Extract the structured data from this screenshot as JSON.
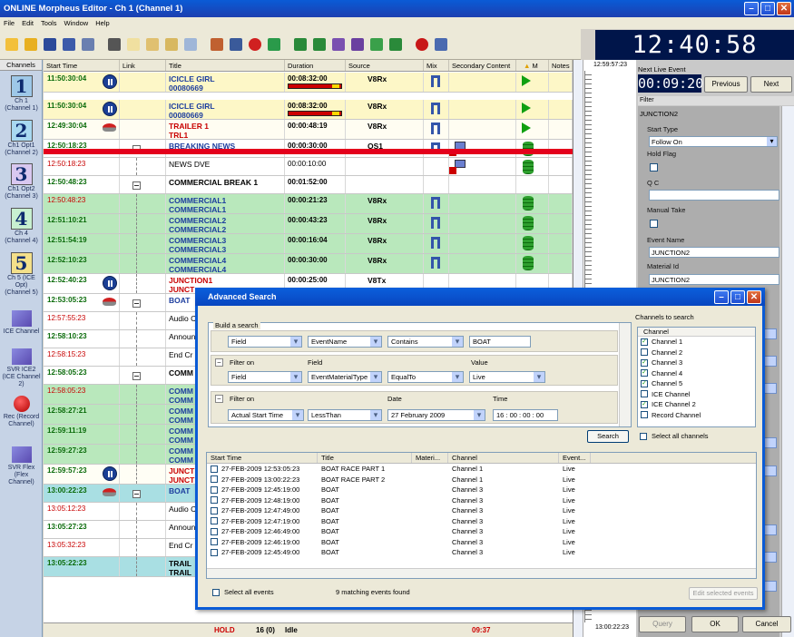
{
  "window": {
    "title": "ONLINE Morpheus Editor - Ch 1 (Channel 1)",
    "menu": [
      "File",
      "Edit",
      "Tools",
      "Window",
      "Help"
    ]
  },
  "clock": "12:40:58",
  "sidebar": {
    "header": "Channels",
    "items": [
      {
        "num": "1",
        "label": "Ch 1 (Channel 1)",
        "color": "#9ec8e8"
      },
      {
        "num": "2",
        "label": "Ch1 Opt1 (Channel 2)",
        "color": "#a8d8f0"
      },
      {
        "num": "3",
        "label": "Ch1 Opt2 (Channel 3)",
        "color": "#d9c8f0"
      },
      {
        "num": "4",
        "label": "Ch 4 (Channel 4)",
        "color": "#c8f0d0"
      },
      {
        "num": "5",
        "label": "Ch 5 (ICE Opt) (Channel 5)",
        "color": "#f4e08a"
      },
      {
        "label": "ICE Channel",
        "icon": "ice-channel-icon"
      },
      {
        "label": "SVR ICE2 (ICE Channel 2)",
        "icon": "server-icon"
      },
      {
        "label": "Rec (Record Channel)",
        "icon": "record-icon"
      },
      {
        "label": "SVR Flex (Flex Channel)",
        "icon": "server-icon"
      }
    ]
  },
  "grid": {
    "columns": [
      "Start Time",
      "Link",
      "Title",
      "Duration",
      "Source",
      "Mix",
      "Secondary Content",
      "M",
      "Notes"
    ],
    "rows": [
      {
        "time": "11:50:30:04",
        "tc": "green",
        "title": "ICICLE GIRL",
        "title2": "00080669",
        "ttc": "blue",
        "dur": "00:08:32:00",
        "bar": true,
        "src": "V8Rx",
        "bg": "#fdf7c7",
        "icon": "pause",
        "mix": true,
        "status": "play"
      },
      {
        "time": "11:50:30:04",
        "tc": "green",
        "title": "ICICLE GIRL",
        "title2": "00080669",
        "ttc": "blue",
        "dur": "00:08:32:00",
        "bar": true,
        "src": "V8Rx",
        "bg": "#fdf7c7",
        "icon": "pause",
        "mix": true,
        "status": "play"
      },
      {
        "time": "12:49:30:04",
        "tc": "green",
        "title": "TRAILER 1",
        "title2": "TRL1",
        "ttc": "red",
        "dur": "00:00:48:19",
        "src": "V8Rx",
        "bg": "#fffdf2",
        "icon": "disc",
        "mix": true,
        "status": "play-end"
      },
      {
        "time": "12:50:18:23",
        "tc": "green",
        "title": "BREAKING NEWS",
        "ttc": "blue",
        "dur": "00:00:30:00",
        "src": "OS1",
        "bg": "#fff",
        "link": true,
        "mix": true,
        "sec": true,
        "status": "db"
      },
      {
        "time": "12:50:18:23",
        "tc": "red",
        "title": "NEWS DVE",
        "ttc": "black",
        "normal": true,
        "dur": "00:00:10:00",
        "bg": "#fff",
        "sec": true,
        "status": "db"
      },
      {
        "time": "12:50:48:23",
        "tc": "green",
        "title": "COMMERCIAL BREAK 1",
        "ttc": "black",
        "dur": "00:01:52:00",
        "bg": "#fff",
        "link": true
      },
      {
        "time": "12:50:48:23",
        "tc": "red",
        "title": "COMMERCIAL1",
        "title2": "COMMERCIAL1",
        "ttc": "blue",
        "dur": "00:00:21:23",
        "src": "V8Rx",
        "bg": "#b9e8bc",
        "mix": true,
        "status": "db"
      },
      {
        "time": "12:51:10:21",
        "tc": "green",
        "title": "COMMERCIAL2",
        "title2": "COMMERCIAL2",
        "ttc": "blue",
        "dur": "00:00:43:23",
        "src": "V8Rx",
        "bg": "#b9e8bc",
        "mix": true,
        "status": "db"
      },
      {
        "time": "12:51:54:19",
        "tc": "green",
        "title": "COMMERCIAL3",
        "title2": "COMMERCIAL3",
        "ttc": "blue",
        "dur": "00:00:16:04",
        "src": "V8Rx",
        "bg": "#b9e8bc",
        "mix": true,
        "status": "db"
      },
      {
        "time": "12:52:10:23",
        "tc": "green",
        "title": "COMMERCIAL4",
        "title2": "COMMERCIAL4",
        "ttc": "blue",
        "dur": "00:00:30:00",
        "src": "V8Rx",
        "bg": "#b9e8bc",
        "mix": true,
        "status": "db"
      },
      {
        "time": "12:52:40:23",
        "tc": "green",
        "title": "JUNCTION1",
        "title2": "JUNCT",
        "ttc": "red",
        "dur": "00:00:25:00",
        "src": "V8Tx",
        "bg": "#fff",
        "icon": "pause"
      },
      {
        "time": "12:53:05:23",
        "tc": "green",
        "title": "BOAT",
        "ttc": "blue",
        "bg": "#fff",
        "icon": "disc",
        "link": true
      },
      {
        "time": "12:57:55:23",
        "tc": "red",
        "title": "Audio C",
        "ttc": "black",
        "normal": true,
        "bg": "#fff"
      },
      {
        "time": "12:58:10:23",
        "tc": "green",
        "title": "Announ",
        "ttc": "black",
        "normal": true,
        "bg": "#fff"
      },
      {
        "time": "12:58:15:23",
        "tc": "red",
        "title": "End Cr",
        "ttc": "black",
        "normal": true,
        "bg": "#fff"
      },
      {
        "time": "12:58:05:23",
        "tc": "green",
        "title": "COMM",
        "ttc": "black",
        "bg": "#fff",
        "link": true
      },
      {
        "time": "12:58:05:23",
        "tc": "red",
        "title": "COMM",
        "title2": "COMM",
        "ttc": "blue",
        "bg": "#b9e8bc"
      },
      {
        "time": "12:58:27:21",
        "tc": "green",
        "title": "COMM",
        "title2": "COMM",
        "ttc": "blue",
        "bg": "#b9e8bc"
      },
      {
        "time": "12:59:11:19",
        "tc": "green",
        "title": "COMM",
        "title2": "COMM",
        "ttc": "blue",
        "bg": "#b9e8bc"
      },
      {
        "time": "12:59:27:23",
        "tc": "green",
        "title": "COMM",
        "title2": "COMM",
        "ttc": "blue",
        "bg": "#b9e8bc"
      },
      {
        "time": "12:59:57:23",
        "tc": "green",
        "title": "JUNCT",
        "title2": "JUNCT",
        "ttc": "red",
        "bg": "#fffef5",
        "icon": "pause"
      },
      {
        "time": "13:00:22:23",
        "tc": "green",
        "title": "BOAT",
        "ttc": "blue",
        "bg": "#a9dfe3",
        "icon": "disc",
        "link": true
      },
      {
        "time": "13:05:12:23",
        "tc": "red",
        "title": "Audio C",
        "ttc": "black",
        "normal": true,
        "bg": "#fff"
      },
      {
        "time": "13:05:27:23",
        "tc": "green",
        "title": "Announ",
        "ttc": "black",
        "normal": true,
        "bg": "#fff"
      },
      {
        "time": "13:05:32:23",
        "tc": "red",
        "title": "End Cr",
        "ttc": "black",
        "normal": true,
        "bg": "#fff"
      },
      {
        "time": "13:05:22:23",
        "tc": "green",
        "title": "TRAIL",
        "title2": "TRAIL",
        "ttc": "black",
        "bg": "#a9dfe3"
      }
    ]
  },
  "status": {
    "state": "HOLD",
    "count": "16 (0)",
    "mode": "Idle",
    "time": "09:37"
  },
  "timeline": {
    "top": "12:59:57:23",
    "bottom": "13:00:22:23"
  },
  "right_panel": {
    "next_live_label": "Next Live Event",
    "next_live_time": "00:09:20",
    "previous": "Previous",
    "next": "Next",
    "filter": "Filter",
    "event_name_header": "JUNCTION2",
    "start_type_label": "Start Type",
    "start_type_value": "Follow On",
    "hold_flag_label": "Hold Flag",
    "qc_label": "Q C",
    "manual_take_label": "Manual Take",
    "event_name_label": "Event Name",
    "event_name_value": "JUNCTION2",
    "material_id_label": "Material Id",
    "material_id_value": "JUNCTION2",
    "query": "Query",
    "ok": "OK",
    "cancel": "Cancel"
  },
  "dialog": {
    "title": "Advanced Search",
    "build_label": "Build a search",
    "channels_label": "Channels to search",
    "row1": {
      "a": "Field",
      "b": "EventName",
      "c": "Contains",
      "d": "BOAT"
    },
    "row2": {
      "filter_on": "Filter on",
      "field_hdr": "Field",
      "value_hdr": "Value",
      "a": "Field",
      "b": "EventMaterialType",
      "c": "EqualTo",
      "d": "Live"
    },
    "row3": {
      "filter_on": "Filter on",
      "date_hdr": "Date",
      "time_hdr": "Time",
      "a": "Actual Start Time",
      "b": "LessThan",
      "c": "27  February  2009",
      "d": "16 : 00 : 00 : 00"
    },
    "search_button": "Search",
    "select_all_channels": "Select all channels",
    "channel_header": "Channel",
    "channels": [
      {
        "name": "Channel 1",
        "checked": true
      },
      {
        "name": "Channel 2",
        "checked": false
      },
      {
        "name": "Channel 3",
        "checked": true
      },
      {
        "name": "Channel 4",
        "checked": true
      },
      {
        "name": "Channel 5",
        "checked": true
      },
      {
        "name": "ICE Channel",
        "checked": false
      },
      {
        "name": "ICE Channel 2",
        "checked": true
      },
      {
        "name": "Record Channel",
        "checked": false
      }
    ],
    "result_columns": [
      "Start Time",
      "Title",
      "Materi...",
      "Channel",
      "Event..."
    ],
    "results": [
      [
        "27-FEB-2009 12:53:05:23",
        "BOAT RACE PART 1",
        "",
        "Channel 1",
        "Live"
      ],
      [
        "27-FEB-2009 13:00:22:23",
        "BOAT RACE PART 2",
        "",
        "Channel 1",
        "Live"
      ],
      [
        "27-FEB-2009 12:45:19:00",
        "BOAT",
        "",
        "Channel 3",
        "Live"
      ],
      [
        "27-FEB-2009 12:48:19:00",
        "BOAT",
        "",
        "Channel 3",
        "Live"
      ],
      [
        "27-FEB-2009 12:47:49:00",
        "BOAT",
        "",
        "Channel 3",
        "Live"
      ],
      [
        "27-FEB-2009 12:47:19:00",
        "BOAT",
        "",
        "Channel 3",
        "Live"
      ],
      [
        "27-FEB-2009 12:46:49:00",
        "BOAT",
        "",
        "Channel 3",
        "Live"
      ],
      [
        "27-FEB-2009 12:46:19:00",
        "BOAT",
        "",
        "Channel 3",
        "Live"
      ],
      [
        "27-FEB-2009 12:45:49:00",
        "BOAT",
        "",
        "Channel 3",
        "Live"
      ]
    ],
    "select_all_events": "Select all events",
    "match_count": "9 matching events found",
    "edit_selected": "Edit selected events"
  }
}
